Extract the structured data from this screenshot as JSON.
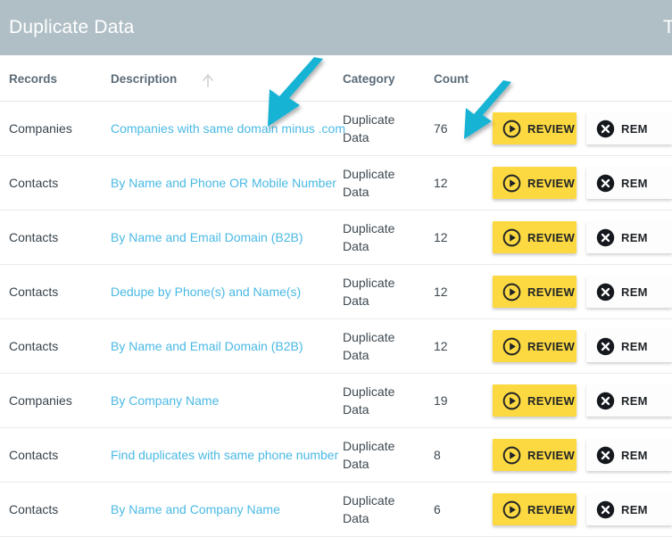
{
  "header": {
    "title": "Duplicate Data",
    "edge_glyph": "T",
    "background_color": "#b0bfc6",
    "title_color": "#ffffff"
  },
  "table": {
    "columns": [
      {
        "key": "records",
        "label": "Records"
      },
      {
        "key": "description",
        "label": "Description",
        "sort": "ascending",
        "sort_icon": "arrow-up-icon"
      },
      {
        "key": "category",
        "label": "Category"
      },
      {
        "key": "count",
        "label": "Count"
      },
      {
        "key": "review",
        "label": ""
      },
      {
        "key": "remove",
        "label": ""
      }
    ],
    "rows": [
      {
        "records": "Companies",
        "description": "Companies with same domain minus .com",
        "category": "Duplicate Data",
        "count": "76",
        "review_label": "REVIEW",
        "remove_label": "REM"
      },
      {
        "records": "Contacts",
        "description": "By Name and Phone OR Mobile Number",
        "category": "Duplicate Data",
        "count": "12",
        "review_label": "REVIEW",
        "remove_label": "REM"
      },
      {
        "records": "Contacts",
        "description": "By Name and Email Domain (B2B)",
        "category": "Duplicate Data",
        "count": "12",
        "review_label": "REVIEW",
        "remove_label": "REM"
      },
      {
        "records": "Contacts",
        "description": "Dedupe by Phone(s) and Name(s)",
        "category": "Duplicate Data",
        "count": "12",
        "review_label": "REVIEW",
        "remove_label": "REM"
      },
      {
        "records": "Contacts",
        "description": "By Name and Email Domain (B2B)",
        "category": "Duplicate Data",
        "count": "12",
        "review_label": "REVIEW",
        "remove_label": "REM"
      },
      {
        "records": "Companies",
        "description": "By Company Name",
        "category": "Duplicate Data",
        "count": "19",
        "review_label": "REVIEW",
        "remove_label": "REM"
      },
      {
        "records": "Contacts",
        "description": "Find duplicates with same phone number",
        "category": "Duplicate Data",
        "count": "8",
        "review_label": "REVIEW",
        "remove_label": "REM"
      },
      {
        "records": "Contacts",
        "description": "By Name and Company Name",
        "category": "Duplicate Data",
        "count": "6",
        "review_label": "REVIEW",
        "remove_label": "REM"
      }
    ]
  },
  "annotations": [
    {
      "name": "arrow-pointing-to-description-link",
      "color": "#18b3d4",
      "direction": "down-left"
    },
    {
      "name": "arrow-pointing-to-count-value",
      "color": "#18b3d4",
      "direction": "down-left"
    }
  ],
  "colors": {
    "link": "#4ab9e4",
    "review_button": "#fcd940",
    "remove_button": "#fdfdfd",
    "header_bar": "#b0bfc6",
    "annotation": "#18b3d4",
    "row_border": "#e8eaec",
    "header_text": "#5b6b78"
  }
}
